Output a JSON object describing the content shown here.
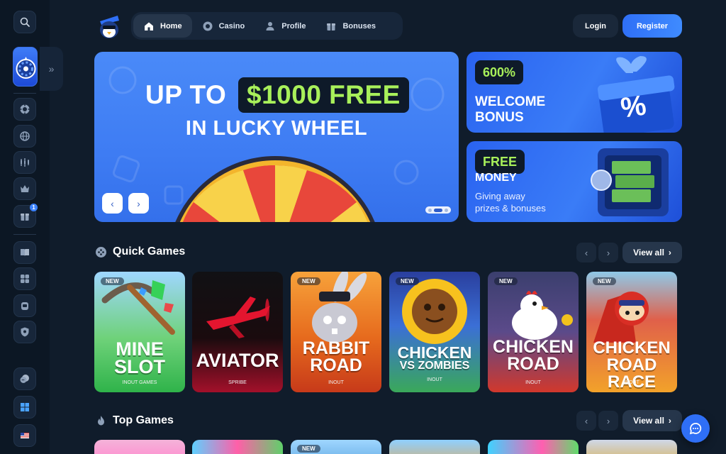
{
  "nav": {
    "tabs": [
      {
        "label": "Home",
        "icon": "home-icon"
      },
      {
        "label": "Casino",
        "icon": "chip-icon"
      },
      {
        "label": "Profile",
        "icon": "user-icon"
      },
      {
        "label": "Bonuses",
        "icon": "gift-icon"
      }
    ],
    "active": "Home"
  },
  "auth": {
    "login": "Login",
    "register": "Register"
  },
  "sidebar": {
    "icons": [
      "search-icon",
      "wheel-icon",
      "chip-icon",
      "globe-icon",
      "chart-icon",
      "crown-icon",
      "gift-icon",
      "book-icon",
      "dice-icon",
      "headset-icon",
      "shield-icon",
      "chat-icon",
      "windows-icon",
      "flag-us-icon"
    ],
    "gift_badge": "1"
  },
  "hero": {
    "line1_prefix": "UP TO",
    "line1_highlight": "$1000 FREE",
    "line2": "IN LUCKY WHEEL"
  },
  "promos": [
    {
      "pill": "600%",
      "title_1": "WELCOME",
      "title_2": "BONUS"
    },
    {
      "pill": "FREE",
      "title_1": "MONEY",
      "sub_1": "Giving away",
      "sub_2": "prizes & bonuses"
    }
  ],
  "quick_games": {
    "title": "Quick Games",
    "view_all": "View all",
    "games": [
      {
        "name_1": "MINE",
        "name_2": "SLOT",
        "provider": "INOUT GAMES",
        "badge": "NEW"
      },
      {
        "name_1": "AVIATOR",
        "name_2": "",
        "provider": "SPRIBE",
        "badge": ""
      },
      {
        "name_1": "RABBIT",
        "name_2": "ROAD",
        "provider": "INOUT",
        "badge": "NEW"
      },
      {
        "name_1": "CHICKEN",
        "name_2": "VS ZOMBIES",
        "provider": "INOUT",
        "badge": "NEW"
      },
      {
        "name_1": "CHICKEN",
        "name_2": "ROAD",
        "provider": "INOUT",
        "badge": "NEW"
      },
      {
        "name_1": "CHICKEN",
        "name_2": "ROAD RACE",
        "provider": "INOUT",
        "badge": "NEW"
      }
    ]
  },
  "top_games": {
    "title": "Top Games",
    "view_all": "View all",
    "first_badge": "NEW"
  },
  "colors": {
    "bg": "#101c2b",
    "accent_blue": "#2f6ff6",
    "accent_green": "#a8f05a"
  }
}
